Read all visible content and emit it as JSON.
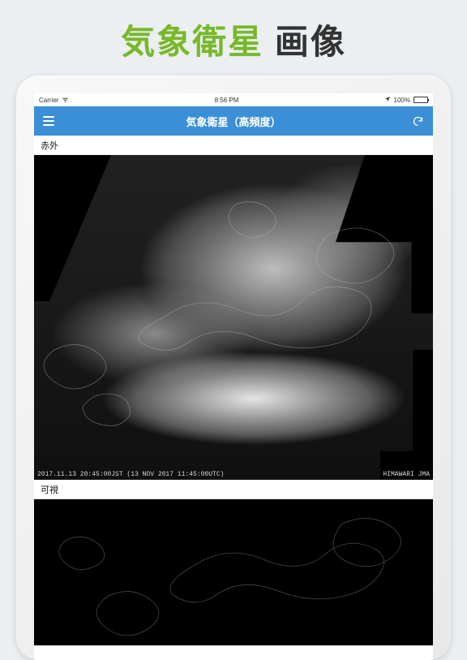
{
  "page": {
    "title_accent": "気象衛星",
    "title_plain": " 画像"
  },
  "ios_status": {
    "carrier": "Carrier",
    "time": "8:56 PM",
    "battery_pct": "100%"
  },
  "navbar": {
    "title": "気象衛星（高頻度）"
  },
  "sections": {
    "infrared_label": "赤外",
    "visible_label": "可視"
  },
  "image_meta": {
    "timestamp": "2017.11.13 20:45:00JST (13 NOV 2017 11:45:00UTC)",
    "source": "HIMAWARI JMA"
  }
}
